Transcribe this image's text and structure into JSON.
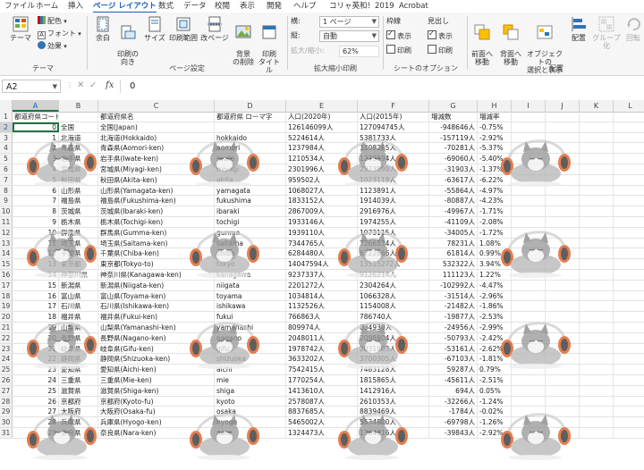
{
  "tabs": [
    "ファイル",
    "ホーム",
    "挿入",
    "ページ レイアウト",
    "数式",
    "データ",
    "校閲",
    "表示",
    "開発",
    "ヘルプ",
    "コリャ英和！2019",
    "Acrobat"
  ],
  "active_tab": "ページ レイアウト",
  "ribbon": {
    "theme": {
      "theme_label": "テーマ",
      "colors_label": "配色",
      "fonts_label": "フォント",
      "effects_label": "効果",
      "group_label": "テーマ"
    },
    "page_setup": {
      "margins_label": "余白",
      "orientation_label": "印刷の\n向き",
      "size_label": "サイズ",
      "print_area_label": "印刷範囲",
      "breaks_label": "改ページ",
      "background_label": "背景\nの削除",
      "print_titles_label": "印刷\nタイトル",
      "group_label": "ページ設定"
    },
    "scale": {
      "width_label": "横:",
      "width_value": "1 ページ",
      "height_label": "縦:",
      "height_value": "自動",
      "scale_label": "拡大/縮小:",
      "scale_value": "62%",
      "group_label": "拡大縮小印刷"
    },
    "sheet_options": {
      "gridlines_label": "枠線",
      "headings_label": "見出し",
      "view_label": "表示",
      "print_label": "印刷",
      "view_label2": "表示",
      "print_label2": "印刷",
      "group_label": "シートのオプション"
    },
    "arrange": {
      "bring_forward_label": "前面へ\n移動",
      "send_backward_label": "背面へ\n移動",
      "selection_pane_label": "オブジェクトの\n選択と表示",
      "align_label": "配置",
      "group_obj_label": "グループ化",
      "rotate_label": "回転",
      "group_label": "配置"
    }
  },
  "formula_bar": {
    "name_box": "A2",
    "cancel_icon": "✕",
    "enter_icon": "✓",
    "fx": "fx",
    "value": "0"
  },
  "columns": [
    "A",
    "B",
    "C",
    "D",
    "E",
    "F",
    "G",
    "H",
    "I",
    "J",
    "K",
    "L"
  ],
  "selected_column": "A",
  "selected_row": "2",
  "rows": [
    {
      "n": "1",
      "a": "都道府県コード",
      "b": "",
      "c": "都道府県名",
      "d": "都道府県 ローマ字",
      "e": "人口(2020年)",
      "f": "人口(2015年)",
      "g": "増減数",
      "h": "増減率"
    },
    {
      "n": "2",
      "a": "0",
      "b": "全国",
      "c": "全国(Japan)",
      "d": "",
      "e": "126146099人",
      "f": "127094745人",
      "g": "-948646人",
      "h": "-0.75%"
    },
    {
      "n": "3",
      "a": "1",
      "b": "北海道",
      "c": "北海道(Hokkaido)",
      "d": "hokkaido",
      "e": "5224614人",
      "f": "5381733人",
      "g": "-157119人",
      "h": "-2.92%"
    },
    {
      "n": "4",
      "a": "2",
      "b": "青森県",
      "c": "青森県(Aomori-ken)",
      "d": "aomori",
      "e": "1237984人",
      "f": "1308265人",
      "g": "-70281人",
      "h": "-5.37%"
    },
    {
      "n": "5",
      "a": "3",
      "b": "岩手県",
      "c": "岩手県(Iwate-ken)",
      "d": "iwate",
      "e": "1210534人",
      "f": "1279594人",
      "g": "-69060人",
      "h": "-5.40%"
    },
    {
      "n": "6",
      "a": "4",
      "b": "宮城県",
      "c": "宮城県(Miyagi-ken)",
      "d": "miyagi",
      "e": "2301996人",
      "f": "2333899人",
      "g": "-31903人",
      "h": "-1.37%"
    },
    {
      "n": "7",
      "a": "5",
      "b": "秋田県",
      "c": "秋田県(Akita-ken)",
      "d": "akita",
      "e": "959502人",
      "f": "1023119人",
      "g": "-63617人",
      "h": "-6.22%"
    },
    {
      "n": "8",
      "a": "6",
      "b": "山形県",
      "c": "山形県(Yamagata-ken)",
      "d": "yamagata",
      "e": "1068027人",
      "f": "1123891人",
      "g": "-55864人",
      "h": "-4.97%"
    },
    {
      "n": "9",
      "a": "7",
      "b": "福島県",
      "c": "福島県(Fukushima-ken)",
      "d": "fukushima",
      "e": "1833152人",
      "f": "1914039人",
      "g": "-80887人",
      "h": "-4.23%"
    },
    {
      "n": "10",
      "a": "8",
      "b": "茨城県",
      "c": "茨城県(Ibaraki-ken)",
      "d": "ibaraki",
      "e": "2867009人",
      "f": "2916976人",
      "g": "-49967人",
      "h": "-1.71%"
    },
    {
      "n": "11",
      "a": "9",
      "b": "栃木県",
      "c": "栃木県(Tochigi-ken)",
      "d": "tochigi",
      "e": "1933146人",
      "f": "1974255人",
      "g": "-41109人",
      "h": "-2.08%"
    },
    {
      "n": "12",
      "a": "10",
      "b": "群馬県",
      "c": "群馬県(Gumma-ken)",
      "d": "gunma",
      "e": "1939110人",
      "f": "1973115人",
      "g": "-34005人",
      "h": "-1.72%"
    },
    {
      "n": "13",
      "a": "11",
      "b": "埼玉県",
      "c": "埼玉県(Saitama-ken)",
      "d": "saitama",
      "e": "7344765人",
      "f": "7266534人",
      "g": "78231人",
      "h": "1.08%"
    },
    {
      "n": "14",
      "a": "12",
      "b": "千葉県",
      "c": "千葉県(Chiba-ken)",
      "d": "chiba",
      "e": "6284480人",
      "f": "6222666人",
      "g": "61814人",
      "h": "0.99%"
    },
    {
      "n": "15",
      "a": "13",
      "b": "東京都",
      "c": "東京都(Tokyo-to)",
      "d": "tokyo",
      "e": "14047594人",
      "f": "13515272人",
      "g": "532322人",
      "h": "3.94%"
    },
    {
      "n": "16",
      "a": "14",
      "b": "神奈川県",
      "c": "神奈川県(Kanagawa-ken)",
      "d": "kanagawa",
      "e": "9237337人",
      "f": "9126214人",
      "g": "111123人",
      "h": "1.22%"
    },
    {
      "n": "17",
      "a": "15",
      "b": "新潟県",
      "c": "新潟県(Niigata-ken)",
      "d": "niigata",
      "e": "2201272人",
      "f": "2304264人",
      "g": "-102992人",
      "h": "-4.47%"
    },
    {
      "n": "18",
      "a": "16",
      "b": "富山県",
      "c": "富山県(Toyama-ken)",
      "d": "toyama",
      "e": "1034814人",
      "f": "1066328人",
      "g": "-31514人",
      "h": "-2.96%"
    },
    {
      "n": "19",
      "a": "17",
      "b": "石川県",
      "c": "石川県(Ishikawa-ken)",
      "d": "ishikawa",
      "e": "1132526人",
      "f": "1154008人",
      "g": "-21482人",
      "h": "-1.86%"
    },
    {
      "n": "20",
      "a": "18",
      "b": "福井県",
      "c": "福井県(Fukui-ken)",
      "d": "fukui",
      "e": "766863人",
      "f": "786740人",
      "g": "-19877人",
      "h": "-2.53%"
    },
    {
      "n": "21",
      "a": "19",
      "b": "山梨県",
      "c": "山梨県(Yamanashi-ken)",
      "d": "yamanashi",
      "e": "809974人",
      "f": "834930人",
      "g": "-24956人",
      "h": "-2.99%"
    },
    {
      "n": "22",
      "a": "20",
      "b": "長野県",
      "c": "長野県(Nagano-ken)",
      "d": "nagano",
      "e": "2048011人",
      "f": "2098804人",
      "g": "-50793人",
      "h": "-2.42%"
    },
    {
      "n": "23",
      "a": "21",
      "b": "岐阜県",
      "c": "岐阜県(Gifu-ken)",
      "d": "gifu",
      "e": "1978742人",
      "f": "2031903人",
      "g": "-53161人",
      "h": "-2.62%"
    },
    {
      "n": "24",
      "a": "22",
      "b": "静岡県",
      "c": "静岡県(Shizuoka-ken)",
      "d": "shizuoka",
      "e": "3633202人",
      "f": "3700305人",
      "g": "-67103人",
      "h": "-1.81%"
    },
    {
      "n": "25",
      "a": "23",
      "b": "愛知県",
      "c": "愛知県(Aichi-ken)",
      "d": "aichi",
      "e": "7542415人",
      "f": "7483128人",
      "g": "59287人",
      "h": "0.79%"
    },
    {
      "n": "26",
      "a": "24",
      "b": "三重県",
      "c": "三重県(Mie-ken)",
      "d": "mie",
      "e": "1770254人",
      "f": "1815865人",
      "g": "-45611人",
      "h": "-2.51%"
    },
    {
      "n": "27",
      "a": "25",
      "b": "滋賀県",
      "c": "滋賀県(Shiga-ken)",
      "d": "shiga",
      "e": "1413610人",
      "f": "1412916人",
      "g": "694人",
      "h": "0.05%"
    },
    {
      "n": "28",
      "a": "26",
      "b": "京都府",
      "c": "京都府(Kyoto-fu)",
      "d": "kyoto",
      "e": "2578087人",
      "f": "2610353人",
      "g": "-32266人",
      "h": "-1.24%"
    },
    {
      "n": "29",
      "a": "27",
      "b": "大阪府",
      "c": "大阪府(Osaka-fu)",
      "d": "osaka",
      "e": "8837685人",
      "f": "8839469人",
      "g": "-1784人",
      "h": "-0.02%"
    },
    {
      "n": "30",
      "a": "28",
      "b": "兵庫県",
      "c": "兵庫県(Hyogo-ken)",
      "d": "hyogo",
      "e": "5465002人",
      "f": "5534800人",
      "g": "-69798人",
      "h": "-1.26%"
    },
    {
      "n": "31",
      "a": "29",
      "b": "奈良県",
      "c": "奈良県(Nara-ken)",
      "d": "nara",
      "e": "1324473人",
      "f": "1364316人",
      "g": "-39843人",
      "h": "-2.92%"
    }
  ],
  "colors": {
    "accent": "#185abd",
    "excel_green": "#217346",
    "ribbon_bg": "#f6f6f6",
    "header_bg": "#f2f2f2"
  },
  "background_image": "cat-with-headphones"
}
